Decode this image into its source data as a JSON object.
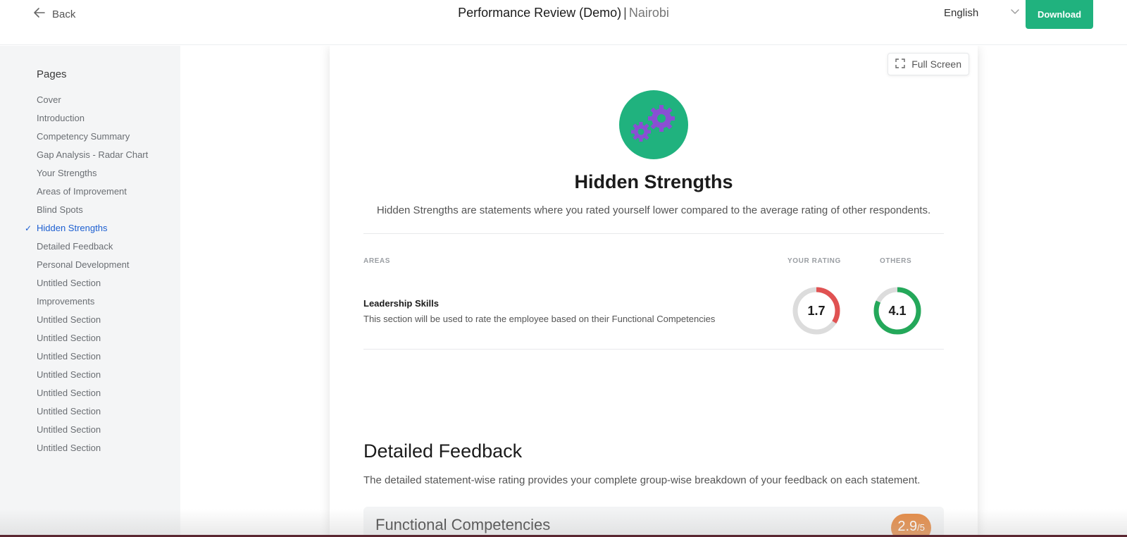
{
  "header": {
    "back_label": "Back",
    "title": "Performance Review (Demo)",
    "separator": "|",
    "location": "Nairobi",
    "language": "English",
    "download_label": "Download"
  },
  "sidebar": {
    "title": "Pages",
    "items": [
      {
        "label": "Cover",
        "active": false
      },
      {
        "label": "Introduction",
        "active": false
      },
      {
        "label": "Competency Summary",
        "active": false
      },
      {
        "label": "Gap Analysis - Radar Chart",
        "active": false
      },
      {
        "label": "Your Strengths",
        "active": false
      },
      {
        "label": "Areas of Improvement",
        "active": false
      },
      {
        "label": "Blind Spots",
        "active": false
      },
      {
        "label": "Hidden Strengths",
        "active": true
      },
      {
        "label": "Detailed Feedback",
        "active": false
      },
      {
        "label": "Personal Development",
        "active": false
      },
      {
        "label": "Untitled Section",
        "active": false
      },
      {
        "label": "Improvements",
        "active": false
      },
      {
        "label": "Untitled Section",
        "active": false
      },
      {
        "label": "Untitled Section",
        "active": false
      },
      {
        "label": "Untitled Section",
        "active": false
      },
      {
        "label": "Untitled Section",
        "active": false
      },
      {
        "label": "Untitled Section",
        "active": false
      },
      {
        "label": "Untitled Section",
        "active": false
      },
      {
        "label": "Untitled Section",
        "active": false
      },
      {
        "label": "Untitled Section",
        "active": false
      }
    ],
    "active_check": "✓"
  },
  "report": {
    "fullscreen_label": "Full Screen",
    "hidden_strengths": {
      "title": "Hidden Strengths",
      "description": "Hidden Strengths are statements where you rated yourself lower compared to the average rating of other respondents.",
      "columns": {
        "areas": "AREAS",
        "your_rating": "YOUR RATING",
        "others": "OTHERS"
      },
      "rows": [
        {
          "name": "Leadership Skills",
          "description": "This section will be used to rate the employee based on their Functional Competencies",
          "your_rating": "1.7",
          "others": "4.1",
          "max": 5
        }
      ]
    },
    "detailed_feedback": {
      "title": "Detailed Feedback",
      "description": "The detailed statement-wise rating provides your complete group-wise breakdown of your feedback on each statement.",
      "group": {
        "title": "Functional Competencies",
        "score": "2.9",
        "score_max": "/5"
      }
    }
  },
  "colors": {
    "accent": "#20b27e",
    "active_link": "#1d5fd1",
    "low_rating": "#e05252",
    "high_rating": "#24a85a",
    "score_badge": "#e48a45",
    "gear": "#8a4fd3"
  }
}
